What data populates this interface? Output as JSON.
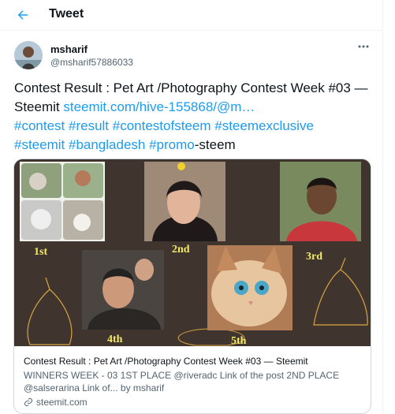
{
  "header": {
    "title": "Tweet",
    "back_icon": "arrow-left-icon"
  },
  "author": {
    "name": "msharif",
    "handle": "@msharif57886033",
    "avatar": "profile-photo"
  },
  "more_icon": "more-dots-icon",
  "tweet": {
    "text_start": "Contest Result : Pet Art /Photography Contest Week #03 — Steemit ",
    "link": "steemit.com/hive-155868/@m…",
    "hashtags": [
      "#contest",
      "#result",
      "#contestofsteem",
      "#steemexclusive",
      "#steemit",
      "#bangladesh",
      "#promo"
    ],
    "suffix": "-steem"
  },
  "card": {
    "title": "Contest Result : Pet Art /Photography Contest Week #03 — Steemit",
    "description": "WINNERS WEEK - 03 1ST PLACE @riveradc Link of the post 2ND PLACE @salserarina Link of... by msharif",
    "domain": "steemit.com",
    "places": [
      "1st",
      "2nd",
      "3rd",
      "4th",
      "5th"
    ]
  },
  "colors": {
    "accent": "#1d9bf0",
    "card_bg": "#3f342e",
    "place_label": "#f2e96a",
    "muted": "#536471"
  }
}
